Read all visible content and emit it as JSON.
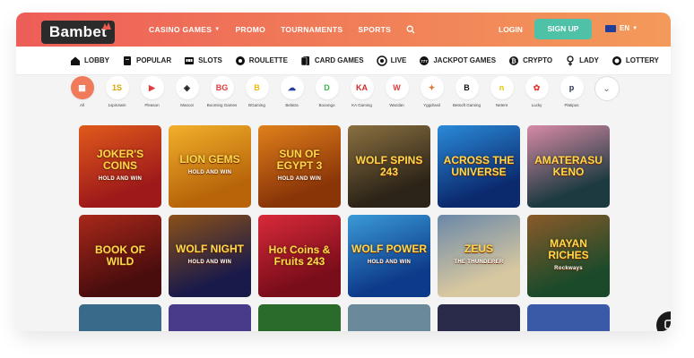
{
  "header": {
    "logo": "Bambet",
    "nav": [
      {
        "label": "CASINO GAMES",
        "has_caret": true
      },
      {
        "label": "PROMO",
        "has_caret": false
      },
      {
        "label": "TOURNAMENTS",
        "has_caret": false
      },
      {
        "label": "SPORTS",
        "has_caret": false
      }
    ],
    "login": "LOGIN",
    "signup": "SIGN UP",
    "language": "EN"
  },
  "categories": [
    {
      "label": "LOBBY",
      "icon": "home-icon"
    },
    {
      "label": "POPULAR",
      "icon": "card-crown-icon"
    },
    {
      "label": "SLOTS",
      "icon": "slot-machine-icon"
    },
    {
      "label": "ROULETTE",
      "icon": "roulette-icon"
    },
    {
      "label": "CARD GAMES",
      "icon": "cards-icon"
    },
    {
      "label": "LIVE",
      "icon": "live-icon"
    },
    {
      "label": "JACKPOT GAMES",
      "icon": "jackpot-icon"
    },
    {
      "label": "CRYPTO",
      "icon": "bitcoin-icon"
    },
    {
      "label": "LADY",
      "icon": "lady-icon"
    },
    {
      "label": "LOTTERY",
      "icon": "lottery-icon"
    }
  ],
  "providers": [
    {
      "name": "All",
      "logo": "▦",
      "color": "#ffffff",
      "active": true
    },
    {
      "name": "1spin4win",
      "logo": "1S",
      "color": "#d9a400"
    },
    {
      "name": "Pleason",
      "logo": "▶",
      "color": "#e23b3b"
    },
    {
      "name": "Mascot",
      "logo": "◈",
      "color": "#222222"
    },
    {
      "name": "Booming Games",
      "logo": "BG",
      "color": "#e23b3b"
    },
    {
      "name": "BGaming",
      "logo": "B",
      "color": "#f4b400"
    },
    {
      "name": "Belatra",
      "logo": "☁",
      "color": "#2a3f9c"
    },
    {
      "name": "Booongo",
      "logo": "D",
      "color": "#3bb54a"
    },
    {
      "name": "KA Gaming",
      "logo": "KA",
      "color": "#d12a2a"
    },
    {
      "name": "Wazdan",
      "logo": "W",
      "color": "#e23b3b"
    },
    {
      "name": "Yggdrasil",
      "logo": "✦",
      "color": "#e07a3b"
    },
    {
      "name": "Betsoft Gaming",
      "logo": "B",
      "color": "#111111"
    },
    {
      "name": "Netent",
      "logo": "n",
      "color": "#e8c400"
    },
    {
      "name": "Lucky",
      "logo": "✿",
      "color": "#e23b3b"
    },
    {
      "name": "Platipus",
      "logo": "p",
      "color": "#1d2a4a"
    }
  ],
  "games": [
    {
      "title": "JOKER'S COINS",
      "sub": "HOLD AND WIN",
      "bg": "#9e1a1a",
      "bg2": "#e05a1b"
    },
    {
      "title": "LION GEMS",
      "sub": "HOLD AND WIN",
      "bg": "#b8650a",
      "bg2": "#f2b02a"
    },
    {
      "title": "SUN OF EGYPT 3",
      "sub": "HOLD AND WIN",
      "bg": "#8a3508",
      "bg2": "#e0801b"
    },
    {
      "title": "WOLF SPINS 243",
      "sub": "",
      "bg": "#2c2418",
      "bg2": "#8a7040"
    },
    {
      "title": "ACROSS THE UNIVERSE",
      "sub": "",
      "bg": "#0b2a6e",
      "bg2": "#2a8ad8"
    },
    {
      "title": "AMATERASU KENO",
      "sub": "",
      "bg": "#1c3a40",
      "bg2": "#d88aa6"
    },
    {
      "title": "BOOK OF WILD",
      "sub": "",
      "bg": "#4a0d0d",
      "bg2": "#a8281a"
    },
    {
      "title": "WOLF NIGHT",
      "sub": "HOLD AND WIN",
      "bg": "#1a1a4a",
      "bg2": "#8a5018"
    },
    {
      "title": "Hot Coins & Fruits 243",
      "sub": "",
      "bg": "#7a0d1a",
      "bg2": "#d82a3a"
    },
    {
      "title": "WOLF POWER",
      "sub": "HOLD AND WIN",
      "bg": "#0d3a8a",
      "bg2": "#3a9ad8"
    },
    {
      "title": "ZEUS",
      "sub": "THE THUNDERER",
      "bg": "#d8c8a0",
      "bg2": "#6a88a8"
    },
    {
      "title": "MAYAN RICHES",
      "sub": "Rockways",
      "bg": "#1a4a2a",
      "bg2": "#8a5a2a"
    }
  ],
  "colors": {
    "header_start": "#ee5d58",
    "header_end": "#f39a5a",
    "signup": "#4fc1a6"
  }
}
